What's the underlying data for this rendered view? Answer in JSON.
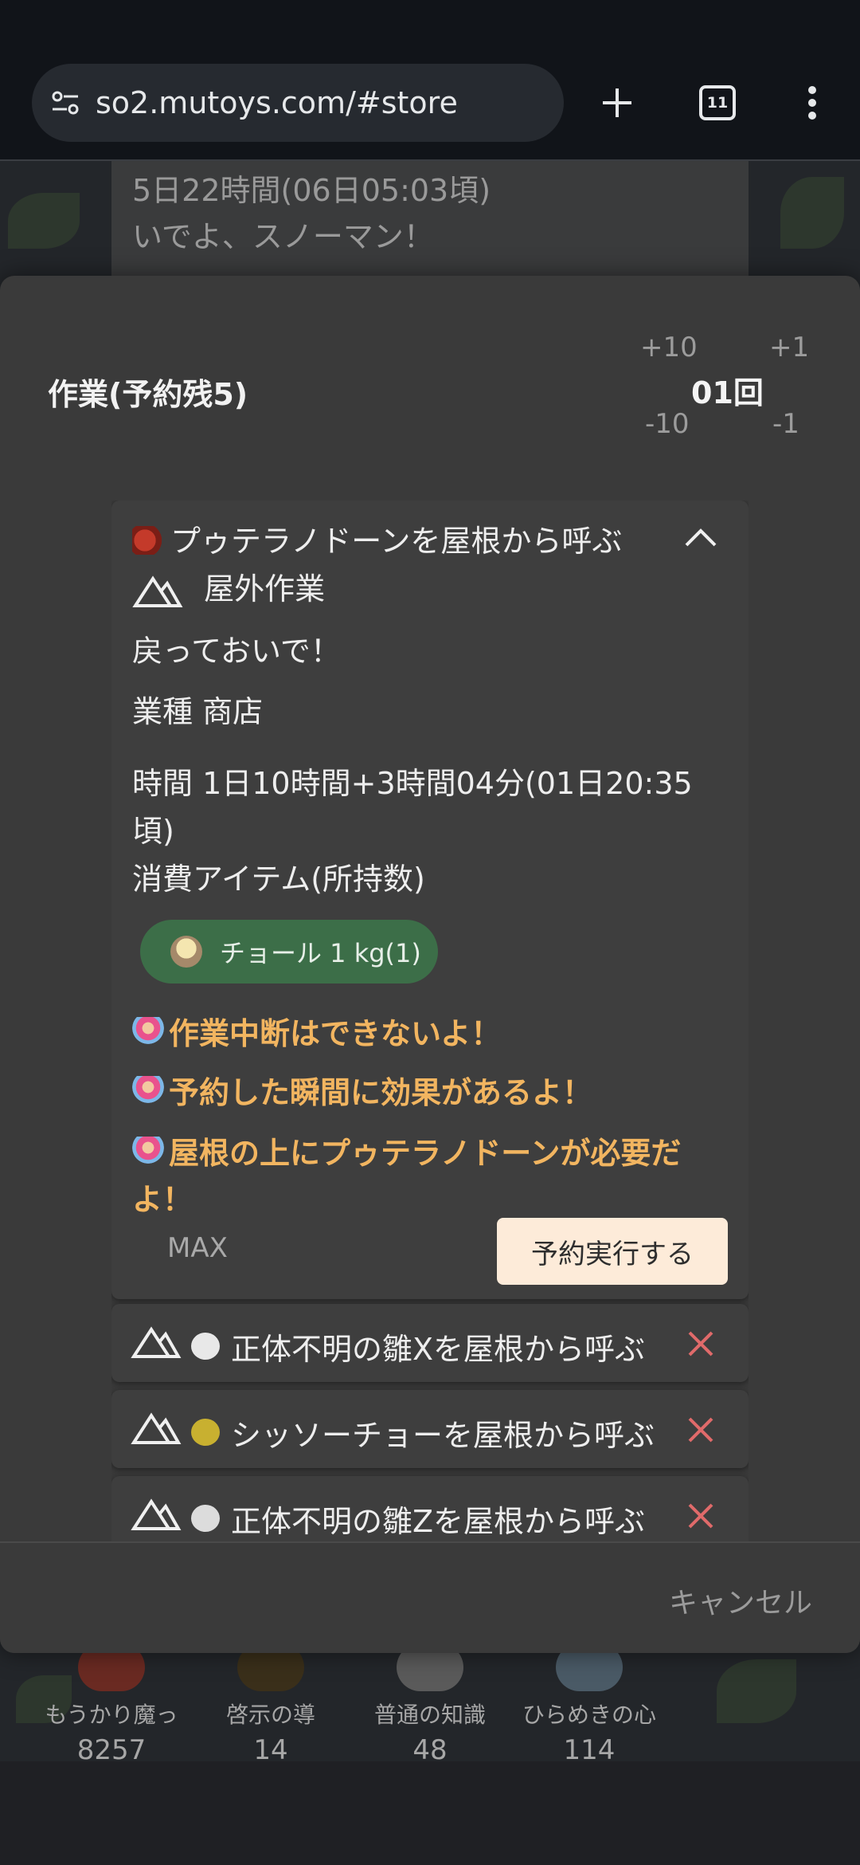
{
  "browser": {
    "url": "so2.mutoys.com/#store",
    "tab_count": "11"
  },
  "background": {
    "card_line1": "5日22時間(06日05:03頃)",
    "card_line2": "いでよ、スノーマン！",
    "bottom_items": [
      {
        "label": "もうかり魔っ",
        "count": "8257"
      },
      {
        "label": "啓示の導",
        "count": "14"
      },
      {
        "label": "普通の知識",
        "count": "48"
      },
      {
        "label": "ひらめきの心",
        "count": "114"
      }
    ]
  },
  "modal": {
    "title": "作業(予約残5)",
    "stepper": {
      "plus10": "+10",
      "plus1": "+1",
      "minus10": "-10",
      "minus1": "-1"
    },
    "count": "01回",
    "main_card": {
      "title": "プゥテラノドーンを屋根から呼ぶ",
      "category": "屋外作業",
      "flavor": "戻っておいで！",
      "industry": "業種 商店",
      "time_line1": "時間 1日10時間+3時間04分(01日20:35",
      "time_line2": "頃)",
      "consume_label": "消費アイテム(所持数)",
      "item_pill": "チョール 1 kg(1)",
      "warnings": [
        "作業中断はできないよ！",
        "予約した瞬間に効果があるよ！",
        "屋根の上にプゥテラノドーンが必要だよ！"
      ],
      "max_label": "MAX",
      "exec_button": "予約実行する"
    },
    "other_tasks": [
      {
        "label": "正体不明の雛Xを屋根から呼ぶ",
        "bird_color": "#e8e8e8"
      },
      {
        "label": "シッソーチョーを屋根から呼ぶ",
        "bird_color": "#c8b030"
      },
      {
        "label": "正体不明の雛Zを屋根から呼ぶ",
        "bird_color": "#dcdcdc"
      }
    ],
    "cancel_button": "キャンセル"
  },
  "colors": {
    "accent_warning": "#f2b560",
    "pill_green": "#3c6e48",
    "exec_button_bg": "#fdebd9",
    "close_red": "#e06a6a"
  }
}
